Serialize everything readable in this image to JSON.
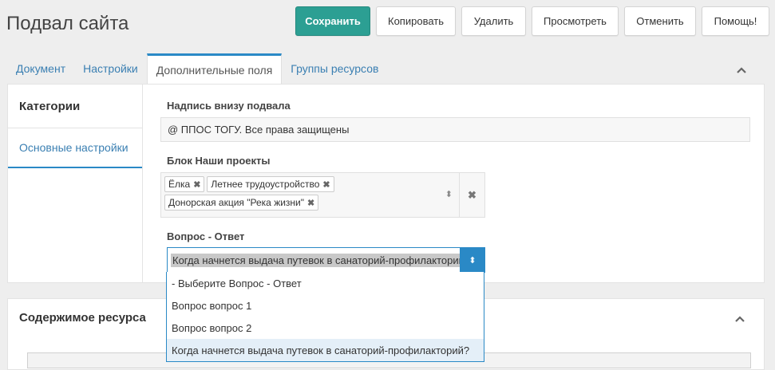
{
  "page": {
    "title": "Подвал сайта"
  },
  "actions": {
    "save": "Сохранить",
    "copy": "Копировать",
    "delete": "Удалить",
    "view": "Просмотреть",
    "cancel": "Отменить",
    "help": "Помощь!"
  },
  "tabs": [
    {
      "label": "Документ"
    },
    {
      "label": "Настройки"
    },
    {
      "label": "Дополнительные поля",
      "active": true
    },
    {
      "label": "Группы ресурсов"
    }
  ],
  "vtabs": {
    "category": "Категории",
    "basic": "Основные настройки"
  },
  "fields": {
    "footer_label": "Надпись внизу подвала",
    "footer_value": "@ ППОС ТОГУ. Все права защищены",
    "projects_label": "Блок Наши проекты",
    "projects": [
      "Ёлка",
      "Летнее трудоустройство",
      "Донорская акция \"Река жизни\""
    ],
    "qa_label": "Вопрос - Ответ",
    "qa_selected": "Когда начнется выдача путевок в санаторий-профилакторий?",
    "qa_options": [
      "- Выберите Вопрос - Ответ",
      "Вопрос вопрос 1",
      "Вопрос вопрос 2",
      "Когда начнется выдача путевок в санаторий-профилакторий?"
    ]
  },
  "content_panel": {
    "title": "Содержимое ресурса"
  },
  "colors": {
    "primary": "#2c9f93",
    "accent": "#2a89c6",
    "link": "#3a7fb2"
  },
  "icons": {
    "remove_chip": "close-icon",
    "select_arrows": "sort-arrows-icon",
    "clear": "close-icon",
    "collapse": "chevron-up-icon"
  }
}
